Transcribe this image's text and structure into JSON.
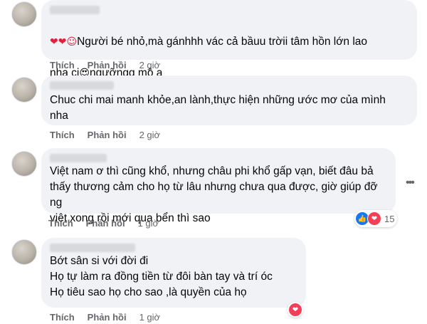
{
  "comments": [
    {
      "line1": "Người bé nhỏ,mà gánhhh vác cả bầuu trờii tâm hồn lớn lao",
      "line2_a": "nha cị",
      "line2_b": "ngưỡngg mộ ạ",
      "like": "Thích",
      "reply": "Phản hồi",
      "time": "2 giờ",
      "emoji_prefix": "❤❤☺",
      "emoji_mid": "😍"
    },
    {
      "text": "Chuc chi mai manh khỏe,an lành,thực hiện những ước mơ của mình\nnha",
      "like": "Thích",
      "reply": "Phản hồi",
      "time": "2 giờ"
    },
    {
      "text": "Việt nam ơ thì cũng khổ, nhưng châu phi khổ gấp vạn, biết đâu bả\nthấy thương cảm cho họ từ lâu nhưng chưa qua được, giờ giúp đỡ ng\nviệt xong rồi mới qua bển thì sao",
      "like": "Thích",
      "reply": "Phản hồi",
      "time": "1 giờ",
      "reaction_count": "15"
    },
    {
      "text": "Bớt sân si với đời đi\nHọ tự làm ra đồng tiền từ đôi bàn tay và trí óc\nHọ tiêu sao họ cho sao ,là quyền của họ",
      "like": "Thích",
      "reply": "Phản hồi",
      "time": "1 giờ"
    }
  ],
  "icons": {
    "more": "more-options-icon",
    "like": "like-reaction-icon",
    "love": "love-reaction-icon"
  },
  "colors": {
    "bubble": "#f0f2f5",
    "meta": "#65676b",
    "love": "#f33e58",
    "like": "#1877f2"
  }
}
